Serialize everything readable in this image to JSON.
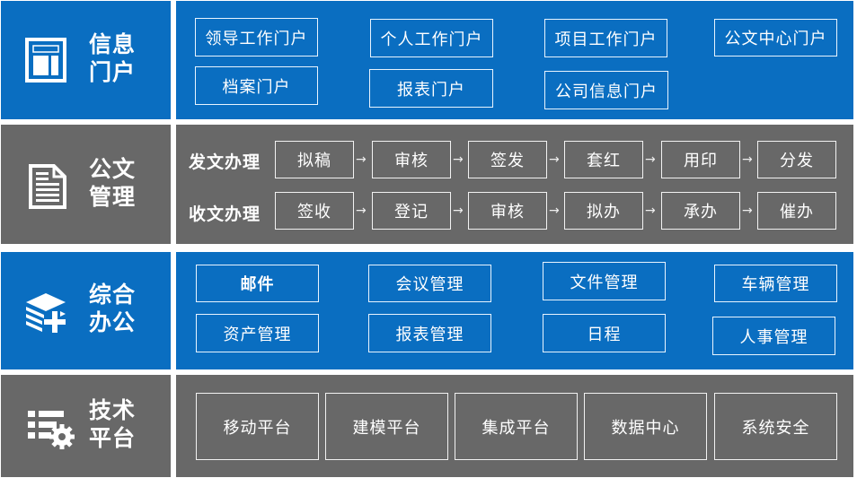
{
  "colors": {
    "blue": "#0a6ec1",
    "gray": "#686868",
    "text": "#ffffff"
  },
  "sections": [
    {
      "title_line1": "信息",
      "title_line2": "门户",
      "icon": "portal-window-icon",
      "items": [
        "领导工作门户",
        "个人工作门户",
        "项目工作门户",
        "公文中心门户",
        "档案门户",
        "报表门户",
        "公司信息门户"
      ]
    },
    {
      "title_line1": "公文",
      "title_line2": "管理",
      "icon": "document-icon",
      "flows": [
        {
          "label": "发文办理",
          "steps": [
            "拟稿",
            "审核",
            "签发",
            "套红",
            "用印",
            "分发"
          ]
        },
        {
          "label": "收文办理",
          "steps": [
            "签收",
            "登记",
            "审核",
            "拟办",
            "承办",
            "催办"
          ]
        }
      ],
      "arrow": "→"
    },
    {
      "title_line1": "综合",
      "title_line2": "办公",
      "icon": "layers-plus-icon",
      "items": [
        "邮件",
        "会议管理",
        "文件管理",
        "车辆管理",
        "资产管理",
        "报表管理",
        "日程",
        "人事管理"
      ]
    },
    {
      "title_line1": "技术",
      "title_line2": "平台",
      "icon": "list-gear-icon",
      "items": [
        "移动平台",
        "建模平台",
        "集成平台",
        "数据中心",
        "系统安全"
      ]
    }
  ]
}
